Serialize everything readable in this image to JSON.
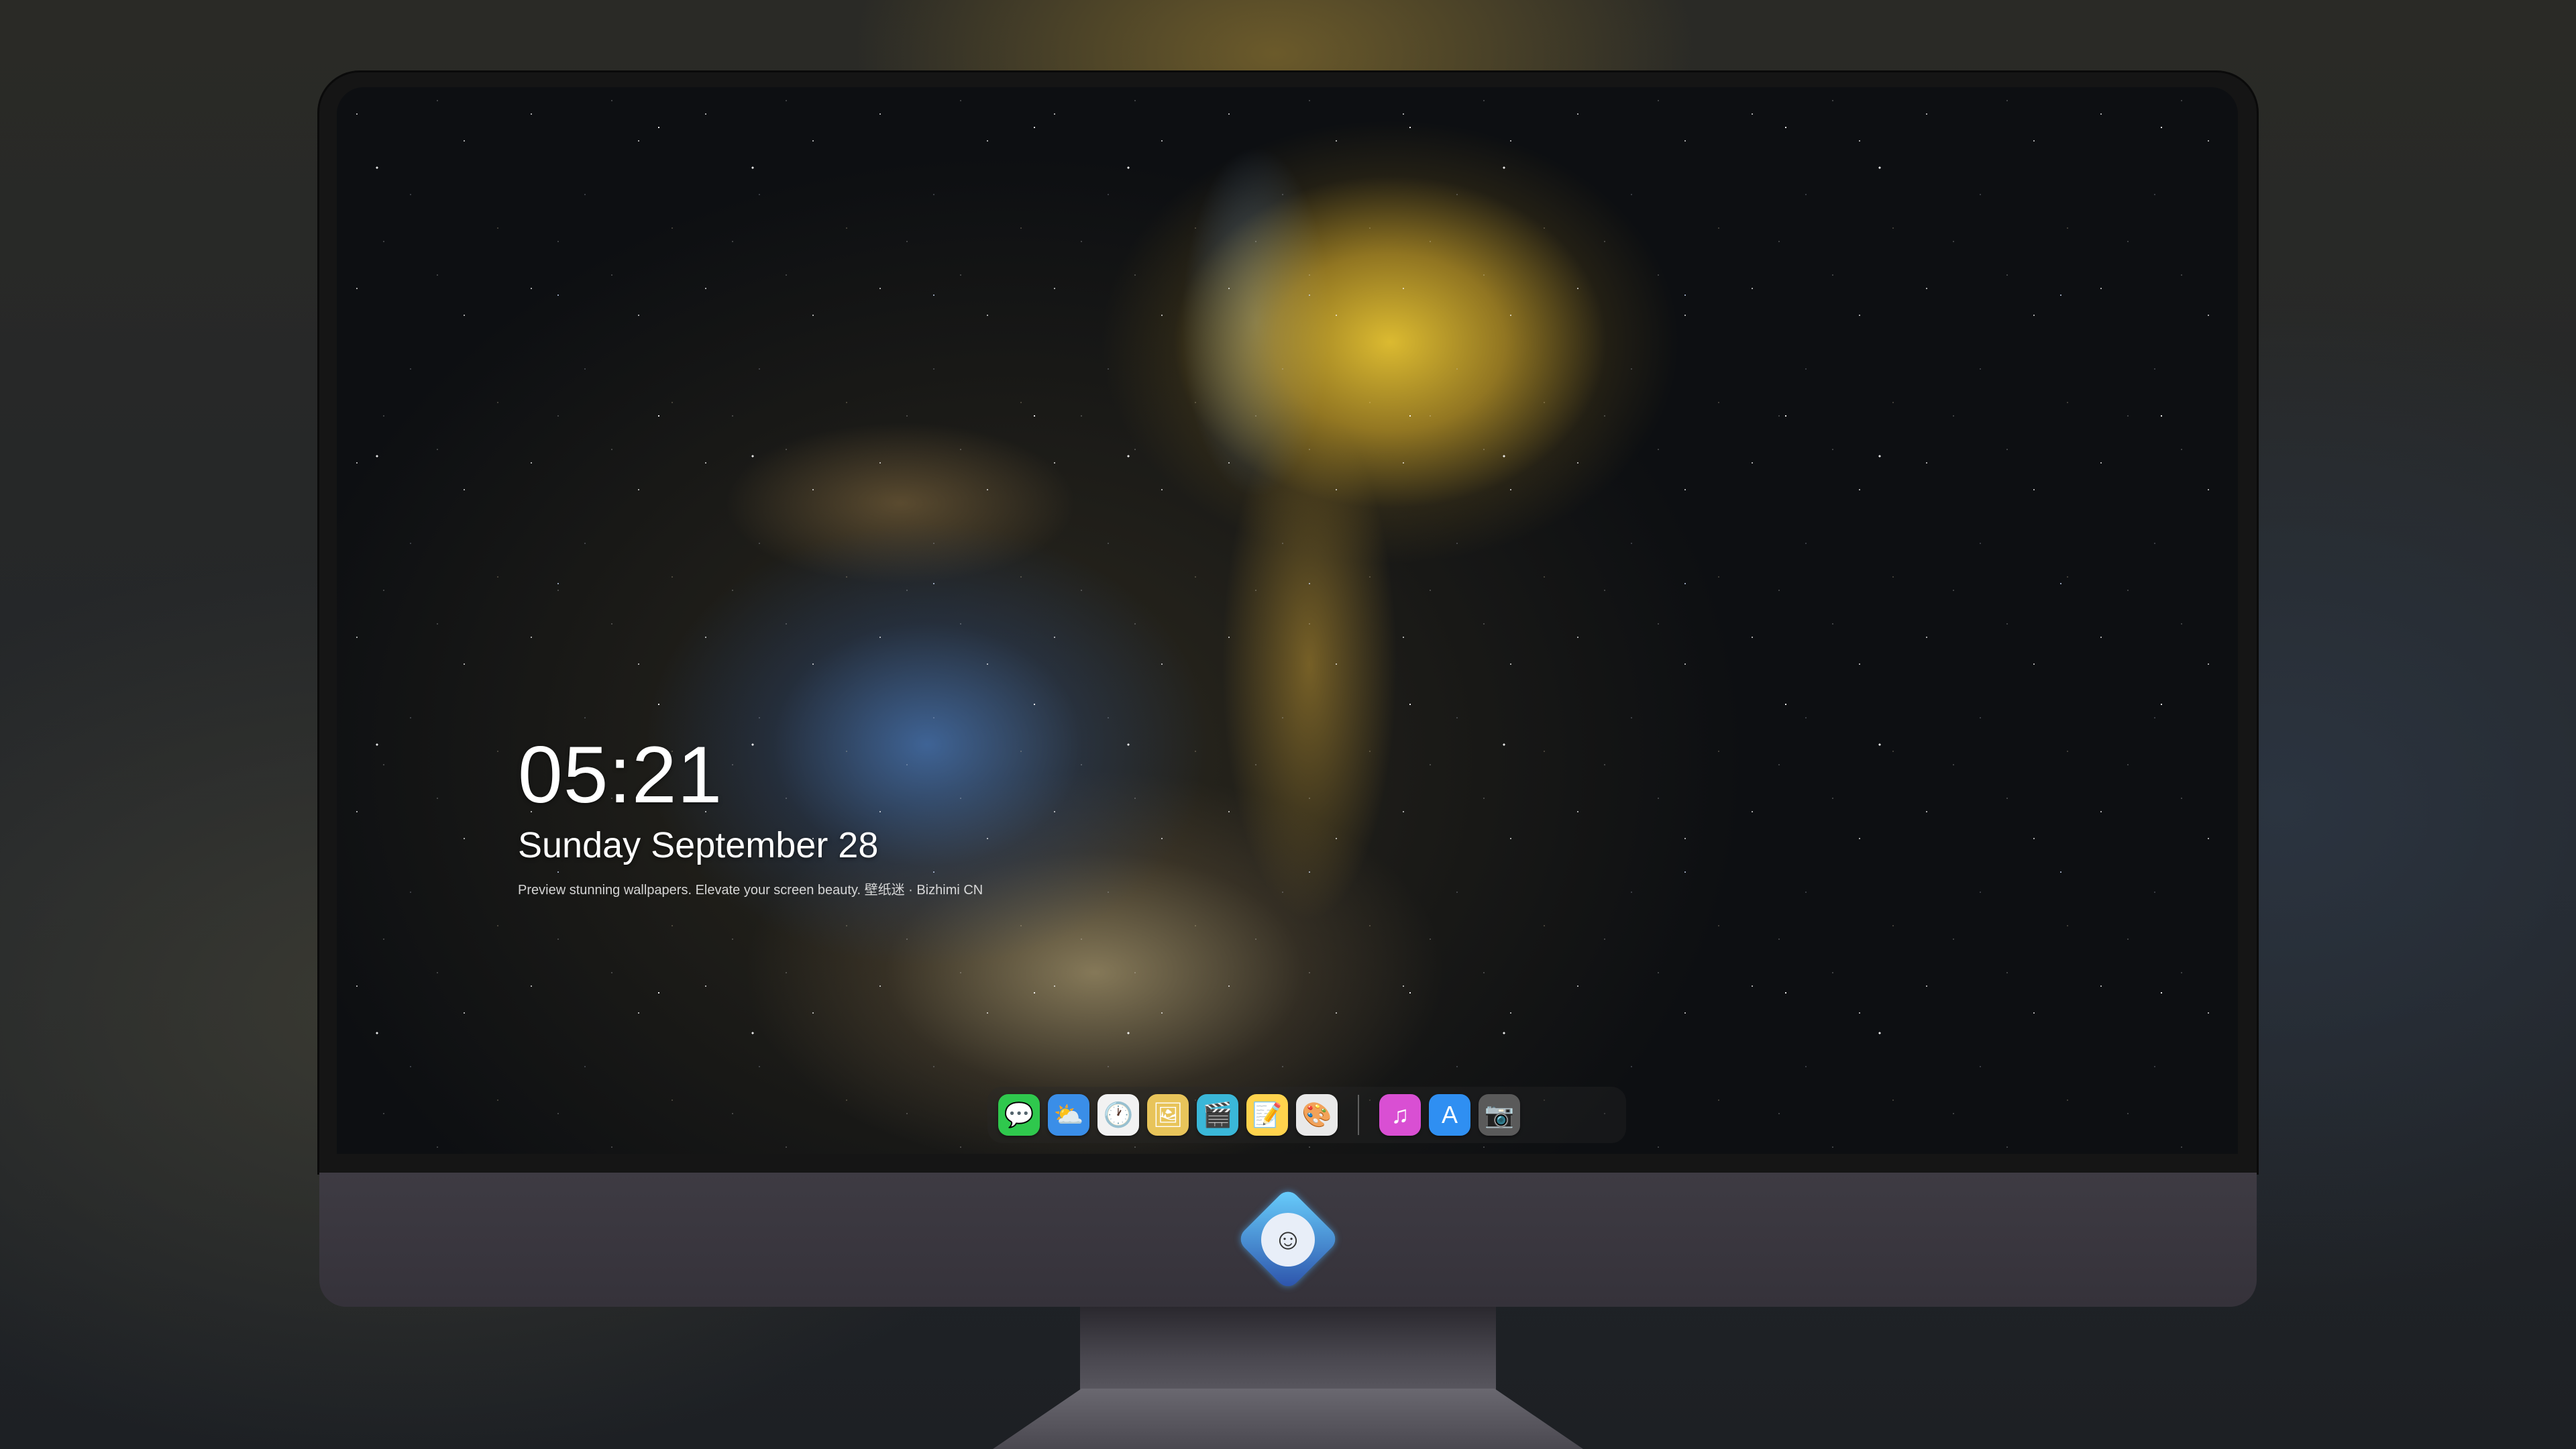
{
  "lockscreen": {
    "time": "05:21",
    "date": "Sunday September  28",
    "tagline": "Preview stunning wallpapers. Elevate your screen beauty. 壁纸迷 · Bizhimi CN"
  },
  "dock": {
    "apps": [
      {
        "name": "Messages",
        "icon": "messages-icon",
        "glyph": "💬",
        "color": "#2fc84d"
      },
      {
        "name": "Weather",
        "icon": "weather-icon",
        "glyph": "⛅",
        "color": "#3a8ee8"
      },
      {
        "name": "Clock",
        "icon": "clock-icon",
        "glyph": "🕐",
        "color": "#f2f2f2"
      },
      {
        "name": "Preview",
        "icon": "preview-icon",
        "glyph": "🖼",
        "color": "#e8c45a"
      },
      {
        "name": "Clips",
        "icon": "clips-icon",
        "glyph": "🎬",
        "color": "#3ab7d8"
      },
      {
        "name": "Notes",
        "icon": "notes-icon",
        "glyph": "📝",
        "color": "#ffd34d"
      },
      {
        "name": "Photos",
        "icon": "photos-icon",
        "glyph": "🎨",
        "color": "#e9e9e9"
      },
      {
        "name": "iTunes",
        "icon": "music-icon",
        "glyph": "♫",
        "color": "#d94fd3"
      },
      {
        "name": "App Store",
        "icon": "app-store-icon",
        "glyph": "A",
        "color": "#2f8ff2"
      },
      {
        "name": "Camera",
        "icon": "camera-icon",
        "glyph": "📷",
        "color": "#5a5a5a"
      }
    ]
  }
}
